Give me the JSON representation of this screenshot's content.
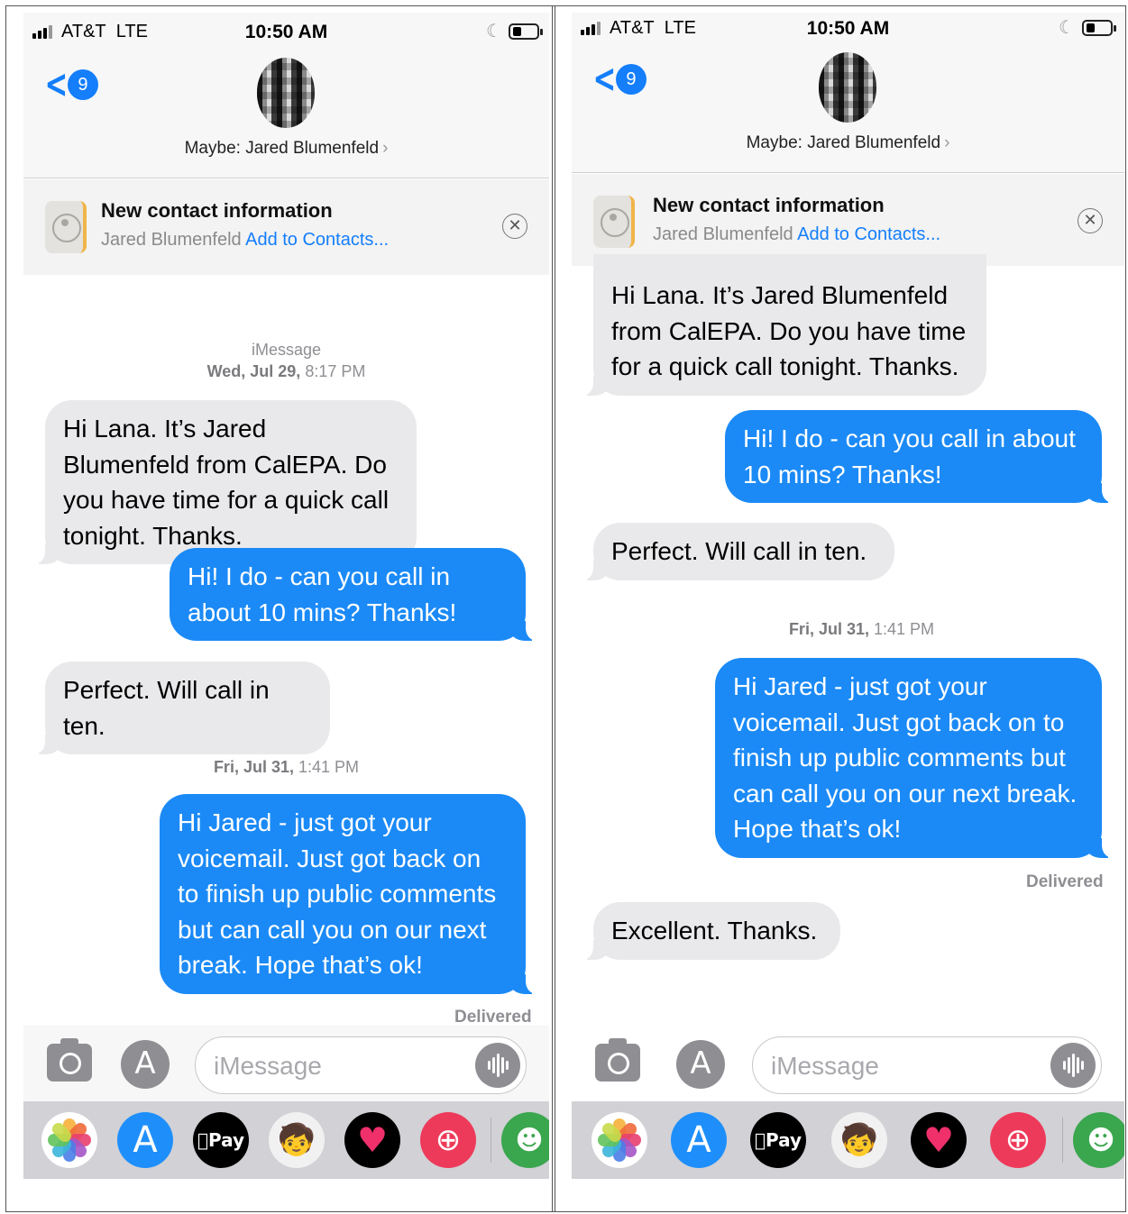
{
  "status": {
    "carrier": "AT&T",
    "network": "LTE",
    "time": "10:50 AM"
  },
  "header": {
    "back_count": "9",
    "contact_name": "Maybe: Jared Blumenfeld",
    "chevron": "›"
  },
  "banner": {
    "title": "New contact information",
    "name": "Jared Blumenfeld",
    "action": "Add to Contacts...",
    "close_icon": "⊗"
  },
  "conversation": {
    "service": "iMessage",
    "stamp1_day": "Wed, Jul 29,",
    "stamp1_time": "8:17 PM",
    "stamp2_day": "Fri, Jul 31,",
    "stamp2_time": "1:41 PM",
    "messages": [
      {
        "direction": "in",
        "text": "Hi Lana. It’s Jared Blumenfeld from CalEPA. Do you have time for a quick call tonight. Thanks."
      },
      {
        "direction": "out",
        "text": "Hi! I do - can you call in about 10 mins? Thanks!"
      },
      {
        "direction": "in",
        "text": "Perfect. Will call in ten."
      },
      {
        "direction": "out",
        "text": "Hi Jared - just got your voicemail. Just got back on to finish up public comments but can call you on our next break. Hope that’s ok!"
      },
      {
        "direction": "in",
        "text": "Excellent. Thanks."
      }
    ],
    "delivered": "Delivered"
  },
  "composer": {
    "placeholder": "iMessage"
  },
  "tray": {
    "apps": [
      "photos-app",
      "app-store-app",
      "apple-pay-app",
      "memoji-app",
      "heart-app",
      "web-search-app",
      "game-app"
    ],
    "pay_label": "Pay"
  },
  "colors": {
    "accent": "#147efb",
    "outgoing": "#1b8af6",
    "incoming": "#e9e9eb"
  }
}
